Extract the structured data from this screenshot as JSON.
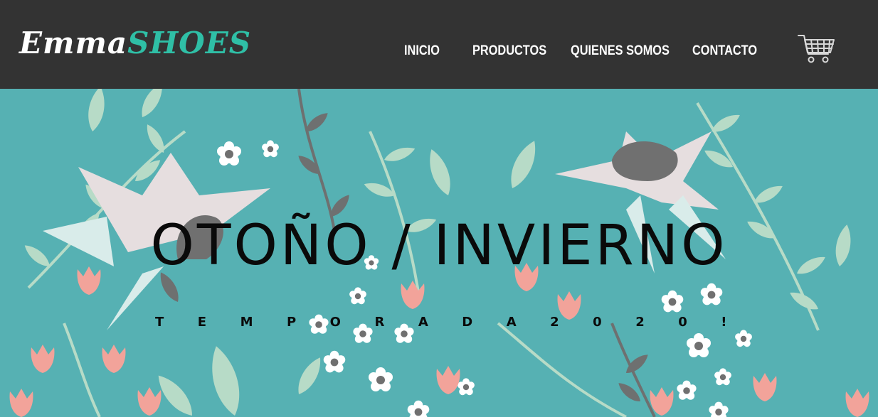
{
  "brand": {
    "part1": "Emma",
    "part2": "SHOES"
  },
  "nav": {
    "items": [
      {
        "label": "INICIO"
      },
      {
        "label": "PRODUCTOS"
      },
      {
        "label": "QUIENES SOMOS"
      },
      {
        "label": "CONTACTO"
      }
    ],
    "cart_icon": "shopping-cart-icon"
  },
  "hero": {
    "title": "OTOÑO / INVIERNO",
    "subtitle": "TEMPORADA2020!"
  },
  "colors": {
    "navbar": "#333333",
    "brand_accent": "#2fbfa6",
    "hero_background": "#56b1b3",
    "leaf_light": "#b7dbc7",
    "flower_pink": "#f2a39a",
    "petal_pale": "#e6dedf",
    "flower_center": "#707070"
  }
}
